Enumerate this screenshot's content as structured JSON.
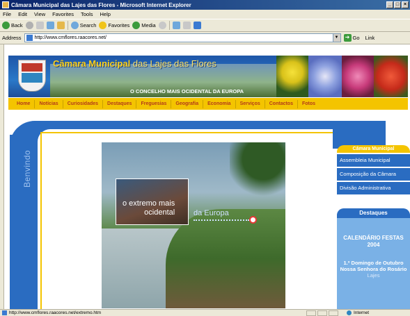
{
  "window": {
    "title": "Câmara Municipal das Lajes das Flores - Microsoft Internet Explorer"
  },
  "menu": [
    "File",
    "Edit",
    "View",
    "Favorites",
    "Tools",
    "Help"
  ],
  "toolbar": {
    "back": "Back",
    "search": "Search",
    "favorites": "Favorites",
    "media": "Media"
  },
  "address": {
    "label": "Address",
    "url": "http://www.cmflores.raacores.net/",
    "go": "Go",
    "links": "Link"
  },
  "site": {
    "title_main": "Câmara Municipal",
    "title_rest": " das Lajes das Flores",
    "slogan": "O CONCELHO MAIS OCIDENTAL DA EUROPA",
    "nav": [
      "Home",
      "Notícias",
      "Curiosidades",
      "Destaques",
      "Freguesias",
      "Geografia",
      "Economia",
      "Serviços",
      "Contactos",
      "Fotos"
    ],
    "welcome": "Benvindo",
    "photo_caption_line1": "o extremo mais",
    "photo_caption_line2": "ocidental",
    "photo_caption_blue": "da Europa",
    "sidebar": {
      "heading": "Câmara Municipal",
      "links": [
        "Assembleia Municipal",
        "Composição da Câmara",
        "Divisão Administrativa"
      ]
    },
    "destaques": {
      "heading": "Destaques",
      "calendar": "CALENDÁRIO FESTAS 2004",
      "event": "1.º Domingo de Outubro Nossa Senhora do Rosário",
      "place": "Lajes"
    }
  },
  "status": {
    "text": "http://www.cmflores.raacores.net/extremo.htm",
    "zone": "Internet"
  },
  "colors": {
    "brand_blue": "#2a6cc1",
    "brand_yellow": "#f4c400",
    "nav_text": "#b23a1a"
  }
}
